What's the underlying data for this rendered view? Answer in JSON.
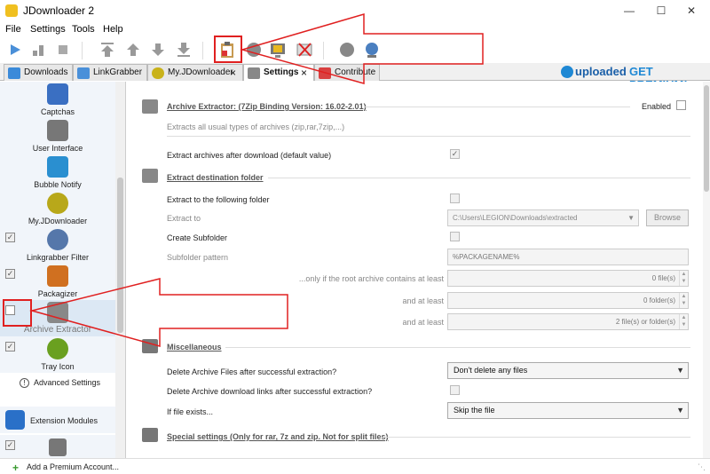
{
  "window": {
    "title": "JDownloader 2"
  },
  "menu": [
    "File",
    "Settings",
    "Tools",
    "Help"
  ],
  "tabs": [
    {
      "label": "Downloads",
      "color": "#3b8ad9"
    },
    {
      "label": "LinkGrabber",
      "color": "#4a90d9"
    },
    {
      "label": "My.JDownloader",
      "color": "#c9b21a"
    },
    {
      "label": "Settings",
      "color": "#777"
    },
    {
      "label": "Contribute",
      "color": "#d94040"
    }
  ],
  "promo": {
    "brand": "uploaded",
    "cta": "GET PREMIUM!"
  },
  "sidebar": {
    "items": [
      {
        "label": "Captchas",
        "color": "#3a6fc2",
        "check": ""
      },
      {
        "label": "User Interface",
        "color": "#777",
        "check": ""
      },
      {
        "label": "Bubble Notify",
        "color": "#2a8fd0",
        "check": ""
      },
      {
        "label": "My.JDownloader",
        "color": "#b8a81a",
        "check": "✓"
      },
      {
        "label": "Linkgrabber Filter",
        "color": "#5577aa",
        "check": "✓"
      },
      {
        "label": "Packagizer",
        "color": "#d07020",
        "check": ""
      },
      {
        "label": "Archive Extractor",
        "color": "#888",
        "check": ""
      },
      {
        "label": "Tray Icon",
        "color": "#6aa020",
        "check": "✓"
      }
    ],
    "advanced": "Advanced Settings",
    "extension": "Extension Modules"
  },
  "extractor": {
    "title": "Archive Extractor: (7Zip Binding Version: 16.02-2.01)",
    "enabled_label": "Enabled",
    "description": "Extracts all usual types of archives (zip,rar,7zip,...)",
    "extract_after": "Extract archives after download (default value)",
    "dest_section": "Extract destination folder",
    "extract_to_folder": "Extract to the following folder",
    "extract_to": "Extract to",
    "path": "C:\\Users\\LEGION\\Downloads\\extracted",
    "browse": "Browse",
    "create_subfolder": "Create Subfolder",
    "subfolder_pattern": "Subfolder pattern",
    "pattern_value": "%PACKAGENAME%",
    "only_if": "...only if the root archive contains at least",
    "files_value": "0 file(s)",
    "and_at_least": "and at least",
    "folders_value": "0 folder(s)",
    "and_at_least2": "and at least",
    "files_or_folders": "2 file(s) or folder(s)",
    "misc_section": "Miscellaneous",
    "delete_archive": "Delete Archive Files after successful extraction?",
    "delete_archive_value": "Don't delete any files",
    "delete_links": "Delete Archive download links after successful extraction?",
    "if_exists": "If file exists...",
    "if_exists_value": "Skip the file",
    "special_section": "Special settings (Only for rar, 7z and zip. Not for split files)"
  },
  "status": {
    "add_premium": "Add a Premium Account..."
  }
}
